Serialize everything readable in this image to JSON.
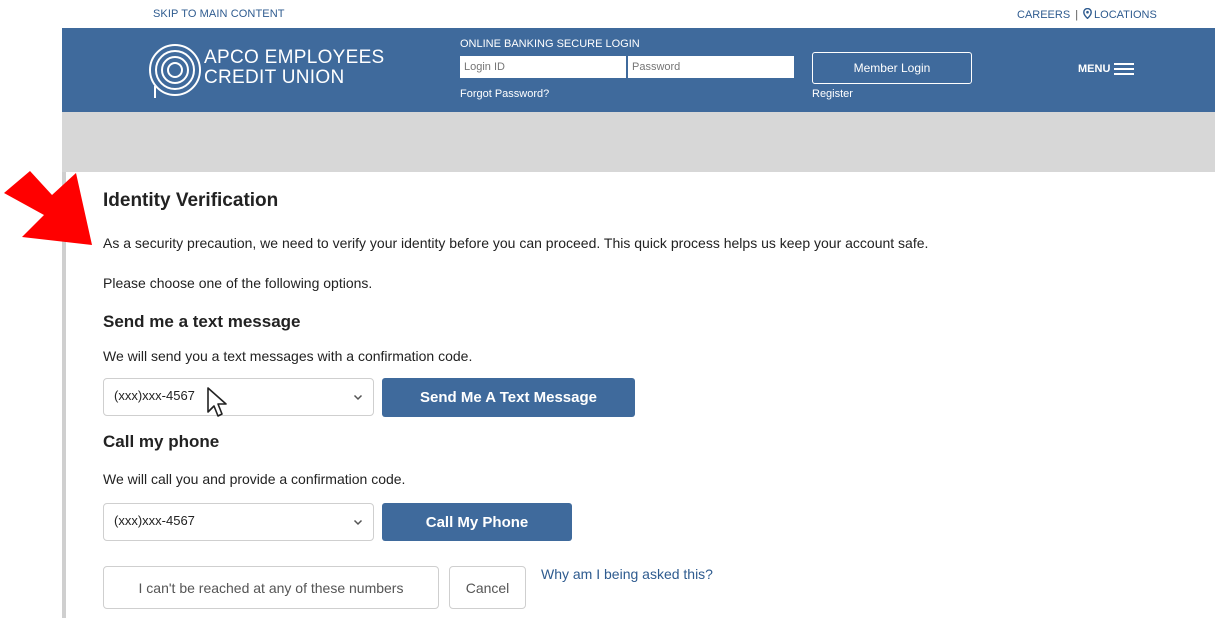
{
  "utility": {
    "skip": "SKIP TO MAIN CONTENT",
    "careers": "CAREERS",
    "separator": "|",
    "locations": "LOCATIONS"
  },
  "header": {
    "brand_line1": "APCO EMPLOYEES",
    "brand_line2": "CREDIT UNION",
    "login_title": "ONLINE BANKING SECURE LOGIN",
    "login_id_placeholder": "Login ID",
    "password_placeholder": "Password",
    "forgot": "Forgot Password?",
    "member_login": "Member Login",
    "register": "Register",
    "menu": "MENU"
  },
  "main": {
    "title": "Identity Verification",
    "intro": "As a security precaution, we need to verify your identity before you can proceed. This quick process helps us keep your account safe.",
    "choose": "Please choose one of the following options.",
    "text_section": {
      "heading": "Send me a text message",
      "desc": "We will send you a text messages with a confirmation code.",
      "selected_number": "(xxx)xxx-4567",
      "button": "Send Me A Text Message"
    },
    "call_section": {
      "heading": "Call my phone",
      "desc": "We will call you and provide a confirmation code.",
      "selected_number": "(xxx)xxx-4567",
      "button": "Call My Phone"
    },
    "unreachable_button": "I can't be reached at any of these numbers",
    "cancel_button": "Cancel",
    "why_link": "Why am I being asked this?"
  },
  "colors": {
    "brand_blue": "#3f6a9c",
    "link_blue": "#2e5b8f",
    "band_gray": "#d7d7d7",
    "arrow_red": "#ff0000"
  }
}
